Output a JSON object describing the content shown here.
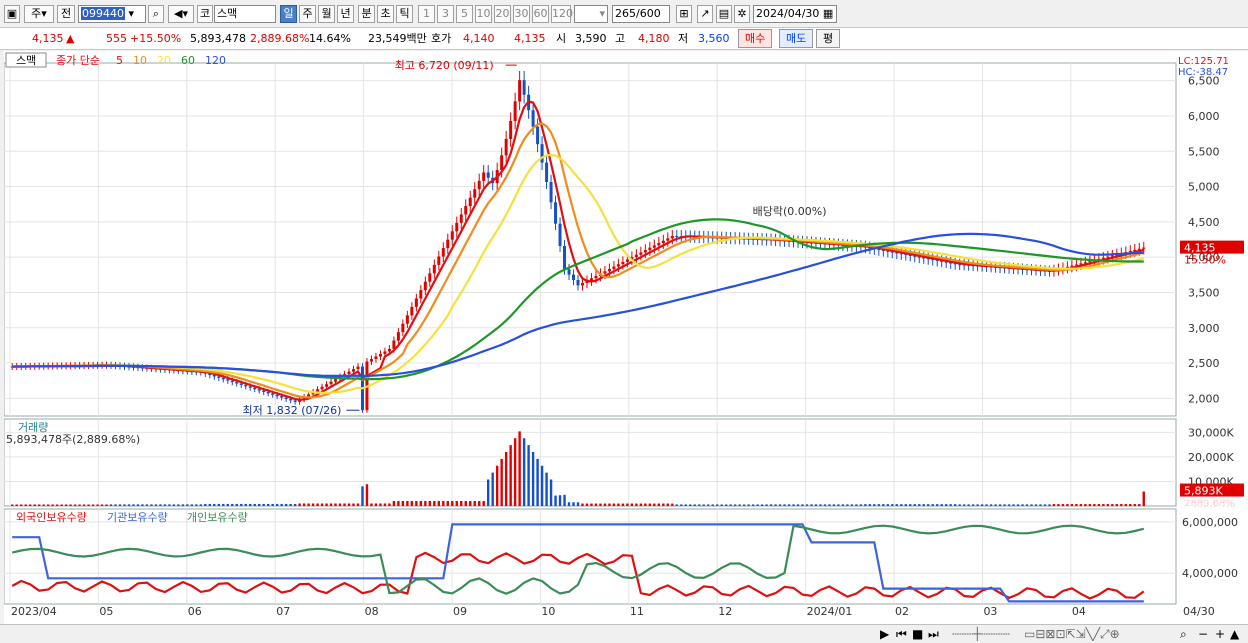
{
  "toolbar": {
    "market_label": "주",
    "prev_label": "전",
    "code": "099440",
    "type_label": "코",
    "stock_name": "스맥",
    "periods": [
      "일",
      "주",
      "월",
      "년",
      "분",
      "초",
      "틱"
    ],
    "active_period": "일",
    "intervals": [
      "1",
      "3",
      "5",
      "10",
      "20",
      "30",
      "60",
      "120"
    ],
    "count": "265",
    "count_total": "/600",
    "date": "2024/04/30"
  },
  "info": {
    "price": "4,135",
    "arrow": "▲",
    "change": "555",
    "change_pct": "+15.50%",
    "volume": "5,893,478",
    "volume_pct": "2,889.68%",
    "turnover_pct": "14.64%",
    "amount": "23,549백만",
    "quote_label": "호가",
    "ask": "4,140",
    "bid": "4,135",
    "open_label": "시",
    "open": "3,590",
    "high_label": "고",
    "high": "4,180",
    "low_label": "저",
    "low": "3,560",
    "buy_label": "매수",
    "sell_label": "매도",
    "avg_label": "평"
  },
  "price_panel": {
    "name_tag": "스맥",
    "legend_prefix": "종가 단순",
    "ma_periods": [
      "5",
      "10",
      "20",
      "60",
      "120"
    ],
    "lc": "LC:125.71",
    "hc": "HC:-38.47",
    "current_price_tag": "4,135",
    "current_pct_tag": "15.50%",
    "high_annotation": "최고 6,720 (09/11)",
    "low_annotation": "최저 1,832 (07/26)",
    "dividend_annotation": "배당락(0.00%)"
  },
  "volume_panel": {
    "title": "거래량",
    "subtitle": "5,893,478주(2,889.68%)",
    "current_tag": "5,893K",
    "current_pct_tag": "2889.68%"
  },
  "holding_panel": {
    "series_labels": [
      "외국인보유수량",
      "기관보유수량",
      "개인보유수량"
    ]
  },
  "colors": {
    "up": "#e00000",
    "down": "#1450c8",
    "ma5": "#e01010",
    "ma10": "#f08c1e",
    "ma20": "#f5e13c",
    "ma60": "#1e9628",
    "ma120": "#2850dc",
    "foreign": "#e01010",
    "institution": "#3c64dc",
    "individual": "#3c8c5a"
  },
  "chart_data": [
    {
      "type": "candlestick",
      "title": "스맥",
      "ylim": [
        1750,
        6750
      ],
      "yticks": [
        2000,
        2500,
        3000,
        3500,
        4000,
        4500,
        5000,
        5500,
        6000,
        6500
      ],
      "ytick_labels": [
        "2,000",
        "2,500",
        "3,000",
        "3,500",
        "4,000",
        "4,500",
        "5,000",
        "5,500",
        "6,000",
        "6,500"
      ],
      "xtick_labels": [
        "2023/04",
        "05",
        "06",
        "07",
        "08",
        "09",
        "10",
        "11",
        "12",
        "2024/01",
        "02",
        "03",
        "04",
        "04/30"
      ],
      "monthly_close_approx": [
        {
          "month": "2023/04",
          "close": 2450
        },
        {
          "month": "2023/05",
          "close": 2470
        },
        {
          "month": "2023/06",
          "close": 2370
        },
        {
          "month": "2023/07",
          "close": 1950
        },
        {
          "month": "2023/08",
          "close": 2700
        },
        {
          "month": "2023/09",
          "close": 5200
        },
        {
          "month": "2023/10",
          "close": 3600
        },
        {
          "month": "2023/11",
          "close": 4300
        },
        {
          "month": "2023/12",
          "close": 4250
        },
        {
          "month": "2024/01",
          "close": 4150
        },
        {
          "month": "2024/02",
          "close": 3900
        },
        {
          "month": "2024/03",
          "close": 3800
        },
        {
          "month": "2024/04",
          "close": 4135
        }
      ],
      "series": [
        {
          "name": "5",
          "kind": "moving_average"
        },
        {
          "name": "10",
          "kind": "moving_average"
        },
        {
          "name": "20",
          "kind": "moving_average"
        },
        {
          "name": "60",
          "kind": "moving_average"
        },
        {
          "name": "120",
          "kind": "moving_average"
        }
      ],
      "last": {
        "date": "2024/04/30",
        "open": 3590,
        "high": 4180,
        "low": 3560,
        "close": 4135
      },
      "max": {
        "date": "09/11",
        "value": 6720
      },
      "min": {
        "date": "07/26",
        "value": 1832
      }
    },
    {
      "type": "bar",
      "title": "거래량",
      "ylim": [
        0,
        33000
      ],
      "yticks": [
        10000,
        20000,
        30000
      ],
      "ytick_labels": [
        "10,000K",
        "20,000K",
        "30,000K"
      ],
      "last_value_k": 5893
    },
    {
      "type": "line",
      "title": "보유수량",
      "yticks": [
        4000000,
        6000000
      ],
      "ytick_labels": [
        "4,000,000",
        "6,000,000"
      ],
      "series": [
        {
          "name": "외국인보유수량"
        },
        {
          "name": "기관보유수량"
        },
        {
          "name": "개인보유수량"
        }
      ]
    }
  ]
}
